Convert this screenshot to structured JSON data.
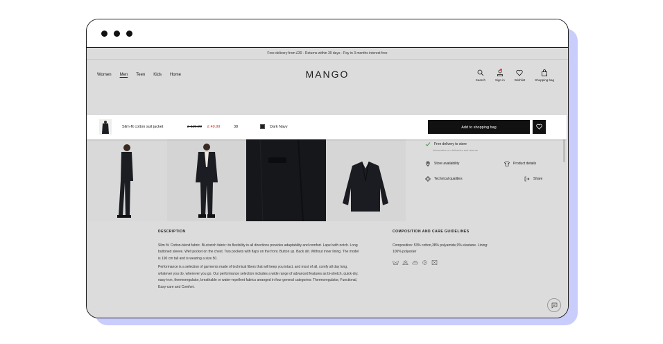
{
  "promo": "Free delivery from £30 - Returns within 30 days - Pay in 3 months interest free",
  "nav": {
    "links": [
      "Women",
      "Men",
      "Teen",
      "Kids",
      "Home"
    ],
    "active": "Men"
  },
  "logo": "MANGO",
  "icons": {
    "search": "Search",
    "signin": "Sign in",
    "wishlist": "Wishlist",
    "bag": "Shopping bag",
    "bag_count": "1"
  },
  "sticky": {
    "name": "Slim-fit cotton suit jacket",
    "old_price": "£ 119.99",
    "new_price": "£ 49.99",
    "size": "38",
    "color": "Dark Navy",
    "add": "Add to shopping bag"
  },
  "right": {
    "delivery": "Free delivery to store",
    "delivery_sub": "Information on deliveries and returns",
    "store": "Store availability",
    "details": "Product details",
    "tech": "Technical qualities",
    "share": "Share"
  },
  "description": {
    "title": "DESCRIPTION",
    "p1": "Slim fit. Cotton-blend fabric. Bi-stretch fabric: its flexibility in all directions provides adaptability and comfort. Lapel with notch. Long buttoned sleeve. Welt pocket on the chest. Two pockets with flaps on the front. Button up. Back slit. Without inner lining. The model is 190 cm tall and is wearing a size 50.",
    "p2": "Performance is a selection of garments made of technical fibers that will keep you intact, and most of all, comfy all day long, whatever you do, wherever you go. Our performance selection includes a wide range of advanced features as bi-stretch, quick-dry, easy-iron, thermoregulator, breathable or water-repellent fabrics arranged in four general categories: Thermoregulator, Functional, Easy-care and Comfort."
  },
  "composition": {
    "title": "COMPOSITION AND CARE GUIDELINES",
    "text": "Composition: 53% cotton,38% polyamide,9% elastane. Lining: 100% polyester"
  }
}
